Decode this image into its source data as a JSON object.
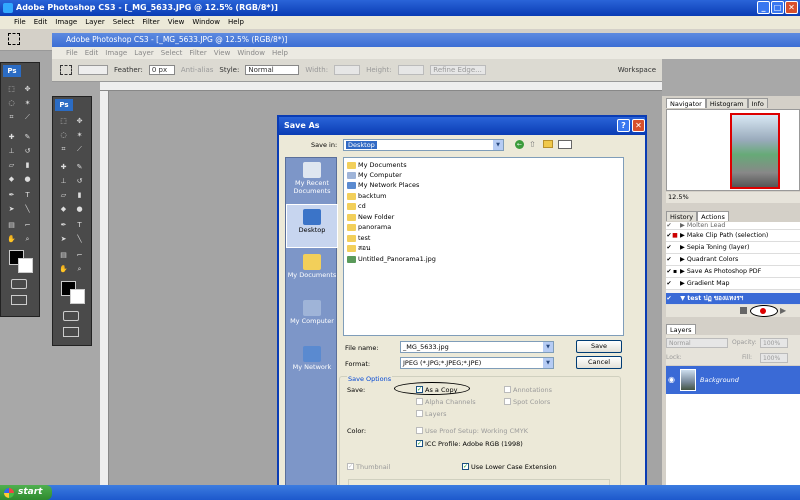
{
  "app": {
    "title": "Adobe Photoshop CS3 - [_MG_5633.JPG @ 12.5% (RGB/8*)]",
    "inner_title": "Adobe Photoshop CS3 - [_MG_5633.JPG @ 12.5% (RGB/8*)]",
    "menu": [
      "File",
      "Edit",
      "Image",
      "Layer",
      "Select",
      "Filter",
      "View",
      "Window",
      "Help"
    ],
    "ps_logo": "Ps"
  },
  "options": {
    "feather_label": "Feather:",
    "feather_value": "0 px",
    "antialias": "Anti-alias",
    "style_label": "Style:",
    "style_value": "Normal",
    "width_label": "Width:",
    "height_label": "Height:",
    "refine": "Refine Edge...",
    "workspace": "Workspace"
  },
  "navigator": {
    "tabs": [
      "Navigator",
      "Histogram",
      "Info"
    ],
    "zoom": "12.5%"
  },
  "actions": {
    "tabs": [
      "History",
      "Actions"
    ],
    "items": [
      "Molten Lead",
      "Make Clip Path (selection)",
      "Sepia Toning (layer)",
      "Quadrant Colors",
      "Save As Photoshop PDF",
      "Gradient Map"
    ],
    "selected": "test ปฏ ของแทงรฯ"
  },
  "layers": {
    "tab": "Layers",
    "mode": "Normal",
    "opacity_label": "Opacity:",
    "opacity": "100%",
    "lock_label": "Lock:",
    "fill_label": "Fill:",
    "fill": "100%",
    "layer_name": "Background"
  },
  "dialog": {
    "title": "Save As",
    "save_in_label": "Save in:",
    "save_in_value": "Desktop",
    "places": [
      "My Recent Documents",
      "Desktop",
      "My Documents",
      "My Computer",
      "My Network"
    ],
    "files": [
      "My Documents",
      "My Computer",
      "My Network Places",
      "backtum",
      "cd",
      "New Folder",
      "panorama",
      "test",
      "สอน",
      "Untitled_Panorama1.jpg"
    ],
    "filename_label": "File name:",
    "filename_value": "_MG_5633.jpg",
    "format_label": "Format:",
    "format_value": "JPEG (*.JPG;*.JPEG;*.JPE)",
    "save_btn": "Save",
    "cancel_btn": "Cancel",
    "save_options": "Save Options",
    "save_label": "Save:",
    "as_copy": "As a Copy",
    "alpha": "Alpha Channels",
    "layers": "Layers",
    "annotations": "Annotations",
    "spot": "Spot Colors",
    "color_label": "Color:",
    "proof": "Use Proof Setup:  Working CMYK",
    "icc": "ICC Profile:  Adobe RGB (1998)",
    "thumbnail": "Thumbnail",
    "lowercase": "Use Lower Case Extension"
  },
  "taskbar": {
    "start": "start"
  },
  "colors": {
    "xp_blue": "#0a3cb4",
    "dialog_bg": "#ece9d8",
    "places_bg": "#7d96c8",
    "selection": "#3a6ad6"
  }
}
